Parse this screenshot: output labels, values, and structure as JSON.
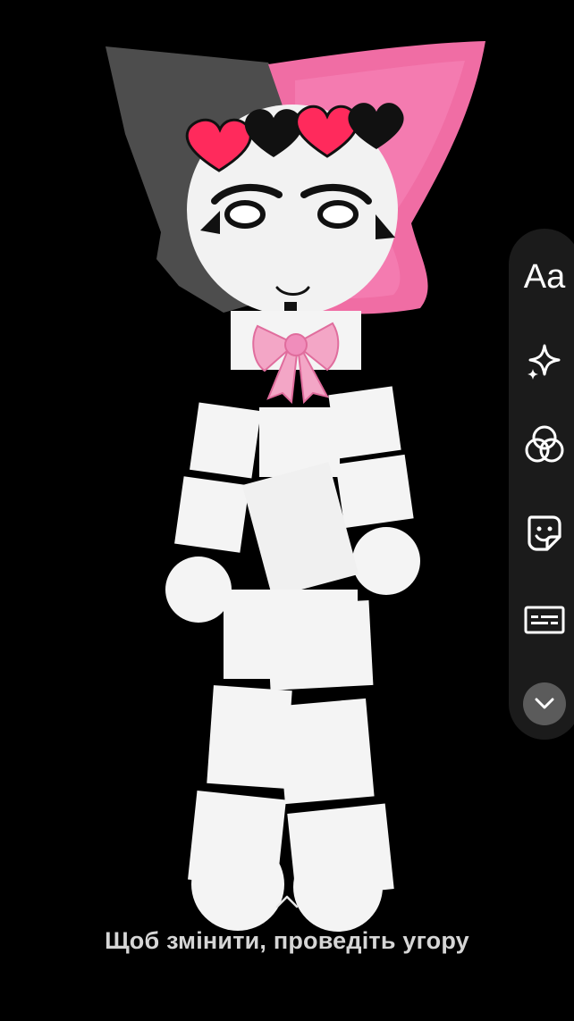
{
  "screen": {
    "background": "#000000"
  },
  "toolbar": {
    "text_tool_label": "Aa",
    "tools": [
      {
        "name": "text-tool",
        "icon": "text-aa-icon"
      },
      {
        "name": "effects-tool",
        "icon": "sparkle-icon"
      },
      {
        "name": "filters-tool",
        "icon": "color-circles-icon"
      },
      {
        "name": "sticker-tool",
        "icon": "sticker-smiley-icon"
      },
      {
        "name": "captions-tool",
        "icon": "captions-icon"
      },
      {
        "name": "collapse-toolbar",
        "icon": "chevron-down-icon"
      }
    ]
  },
  "hint": {
    "swipe_up_text": "Щоб змінити, проведіть угору",
    "icon": "chevron-up-icon"
  },
  "colors": {
    "accent_pink": "#f0609a",
    "hood_gray": "#4a4a4a",
    "heart_red": "#ff2a5c",
    "rail": "#1b1b1b",
    "collapse_button": "#5b5b5b",
    "hint_text": "#d6d6d6"
  }
}
